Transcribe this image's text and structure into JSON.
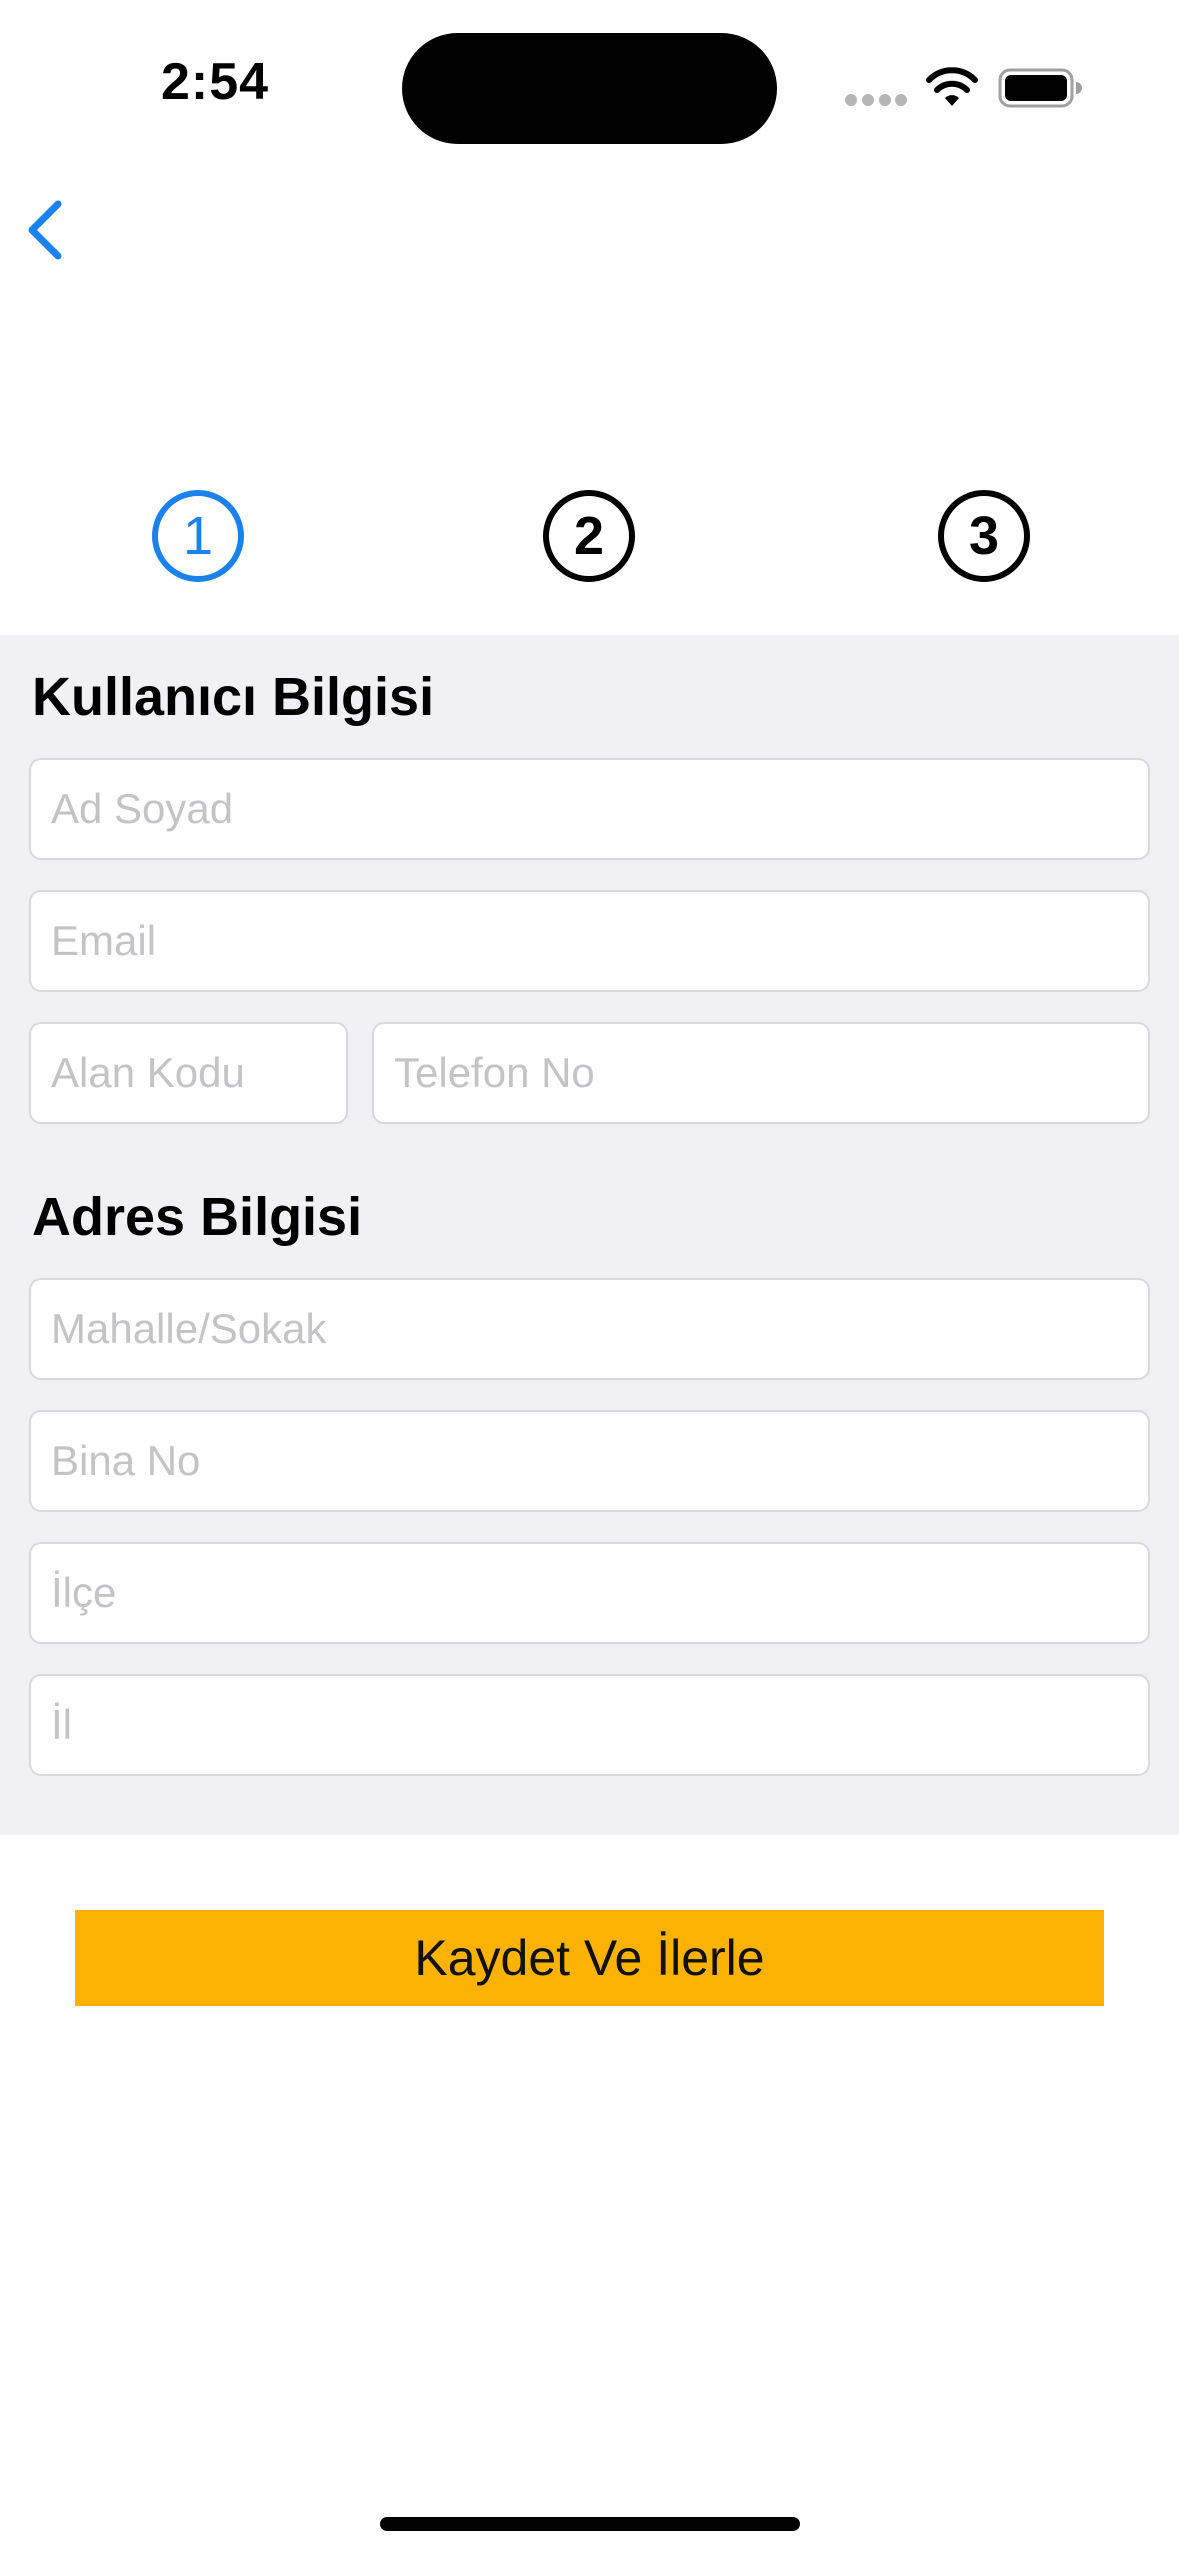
{
  "status_bar": {
    "time": "2:54",
    "icons": [
      "signal-icon",
      "wifi-icon",
      "battery-icon"
    ]
  },
  "nav": {
    "back_icon": "chevron-left-icon"
  },
  "stepper": {
    "steps": [
      "1",
      "2",
      "3"
    ],
    "active_step": "1"
  },
  "user_info": {
    "title": "Kullanıcı Bilgisi",
    "name_placeholder": "Ad Soyad",
    "email_placeholder": "Email",
    "area_code_placeholder": "Alan Kodu",
    "phone_placeholder": "Telefon No"
  },
  "address_info": {
    "title": "Adres Bilgisi",
    "street_placeholder": "Mahalle/Sokak",
    "building_placeholder": "Bina No",
    "district_placeholder": "İlçe",
    "city_placeholder": "İl"
  },
  "actions": {
    "submit_label": "Kaydet Ve İlerle"
  },
  "colors": {
    "accent": "#1a82ec",
    "button": "#fbb202",
    "form_background": "#f1f1f5",
    "placeholder": "#c4c4c7"
  }
}
